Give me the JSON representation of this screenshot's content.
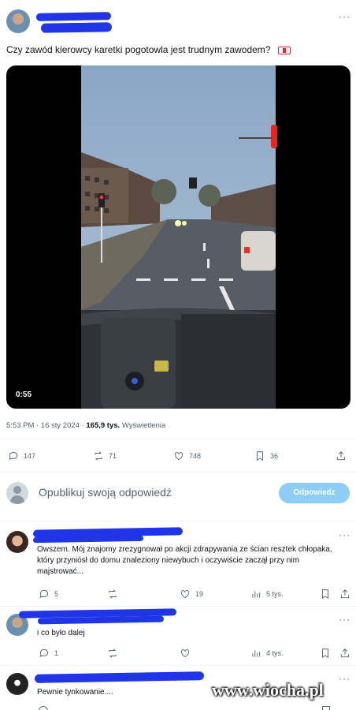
{
  "post": {
    "text": "Czy zawód kierowcy karetki pogotowla jest trudnym zawodem?",
    "video_duration": "0:55",
    "meta_time": "5:53 PM · 16 sty 2024 · ",
    "meta_views": "165,9 tys.",
    "meta_views_label": " Wyświetlenia",
    "stats": {
      "replies": "147",
      "reposts": "71",
      "likes": "748",
      "bookmarks": "36"
    }
  },
  "compose": {
    "placeholder": "Opublikuj swoją odpowiedź",
    "button": "Odpowiedz"
  },
  "replies": [
    {
      "text": "Owszem. Mój znajomy zrezygnował po akcji zdrapywania ze ścian resztek chłopaka, który przyniósł do domu znaleziony niewybuch i oczywiście zaczął przy nim majstrować...",
      "replies": "5",
      "reposts": "",
      "likes": "19",
      "views": "5 tys."
    },
    {
      "text": "i co było dalej",
      "replies": "1",
      "reposts": "",
      "likes": "",
      "views": "4 tys."
    },
    {
      "text": "Pewnie tynkowanie...."
    }
  ],
  "watermark": "www.wiocha.pl",
  "colors": {
    "accent": "#1d9bf0",
    "scribble": "#1f35e6",
    "muted": "#536471"
  }
}
